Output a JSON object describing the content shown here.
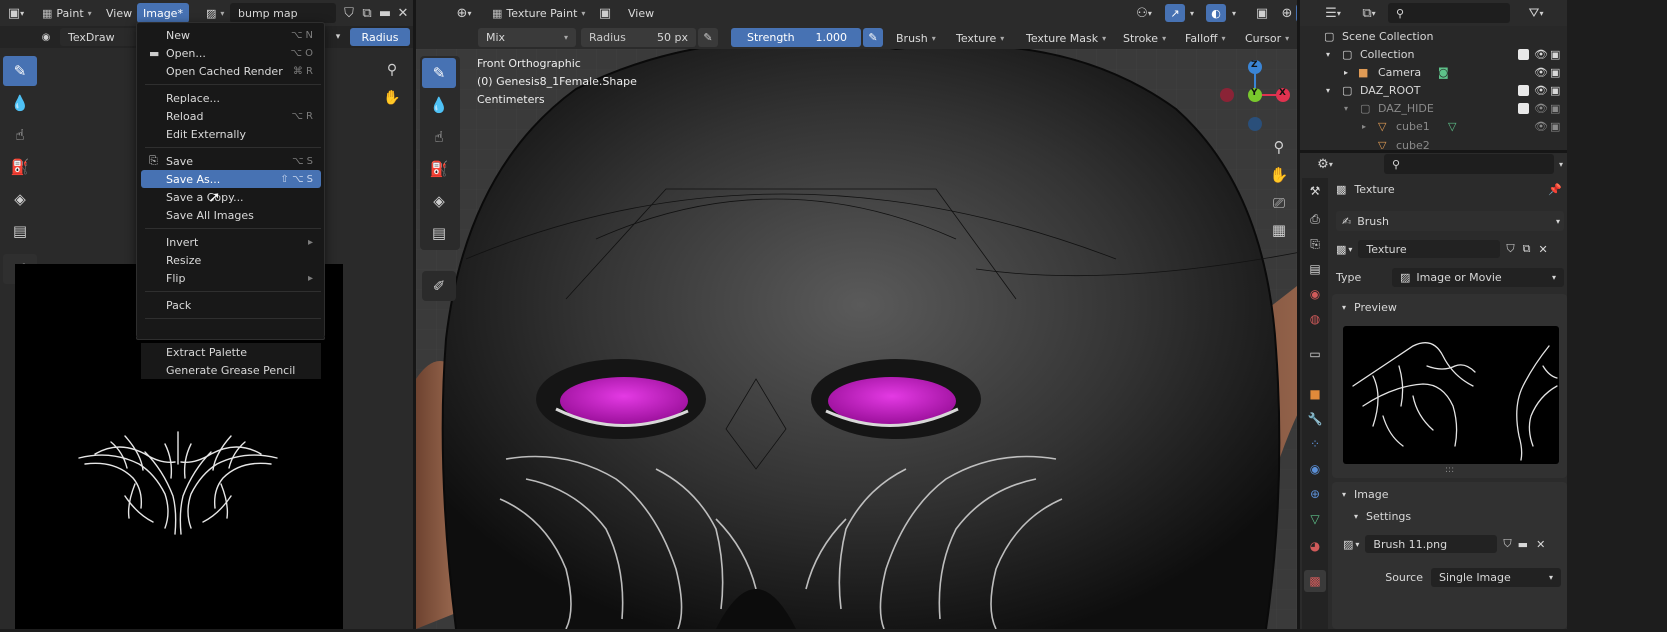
{
  "left_header": {
    "menus": [
      "Paint",
      "View",
      "Image*"
    ],
    "image_name": "bump map"
  },
  "left_tool_settings": {
    "brush_name": "TexDraw",
    "radius_label": "Radius"
  },
  "image_menu": {
    "groups": [
      [
        {
          "label": "New",
          "shortcut": "⌥ N"
        },
        {
          "label": "Open...",
          "shortcut": "⌥ O"
        },
        {
          "label": "Open Cached Render",
          "shortcut": "⌘ R"
        }
      ],
      [
        {
          "label": "Replace...",
          "shortcut": ""
        },
        {
          "label": "Reload",
          "shortcut": "⌥ R"
        },
        {
          "label": "Edit Externally",
          "shortcut": ""
        }
      ],
      [
        {
          "label": "Save",
          "shortcut": "⌥ S"
        },
        {
          "label": "Save As...",
          "shortcut": "⇧ ⌥ S"
        },
        {
          "label": "Save a Copy...",
          "shortcut": ""
        },
        {
          "label": "Save All Images",
          "shortcut": ""
        }
      ],
      [
        {
          "label": "Invert",
          "shortcut": ""
        },
        {
          "label": "Resize",
          "shortcut": ""
        },
        {
          "label": "Flip",
          "shortcut": ""
        }
      ],
      [
        {
          "label": "Pack",
          "shortcut": ""
        }
      ],
      [
        {
          "label": "Extract Palette",
          "shortcut": ""
        },
        {
          "label": "Generate Grease Pencil",
          "shortcut": ""
        }
      ]
    ]
  },
  "viewport_header": {
    "mode": "Texture Paint",
    "view": "View"
  },
  "viewport_tool_settings": {
    "blend": "Mix",
    "radius_label": "Radius",
    "radius_value": "50 px",
    "strength_label": "Strength",
    "strength_value": "1.000",
    "strength_fill": 1.0,
    "menus": [
      "Brush",
      "Texture",
      "Texture Mask",
      "Stroke",
      "Falloff",
      "Cursor"
    ],
    "axes": [
      "X",
      "Y",
      "Z"
    ]
  },
  "viewport_overlay": {
    "view_name": "Front Orthographic",
    "object": "(0) Genesis8_1Female.Shape",
    "units": "Centimeters"
  },
  "gizmo_labels": {
    "z": "Z",
    "y": "Y",
    "x": "X"
  },
  "outliner": {
    "items": [
      {
        "label": "Scene Collection"
      },
      {
        "label": "Collection"
      },
      {
        "label": "Camera"
      },
      {
        "label": "DAZ_ROOT"
      },
      {
        "label": "DAZ_HIDE"
      },
      {
        "label": "cube1"
      },
      {
        "label": "cube2"
      }
    ]
  },
  "properties": {
    "context_label": "Texture",
    "brush_label": "Brush",
    "texture_name": "Texture",
    "type_label": "Type",
    "type_value": "Image or Movie",
    "preview_header": "Preview",
    "image_header": "Image",
    "settings_header": "Settings",
    "image_name": "Brush 11.png",
    "source_label": "Source",
    "source_value": "Single Image"
  },
  "colors": {
    "accent": "#4772b3",
    "eye_magenta": "#c81ec8",
    "axis_x": "#e0324f",
    "axis_y": "#79c82d",
    "axis_z": "#3a85d6"
  }
}
